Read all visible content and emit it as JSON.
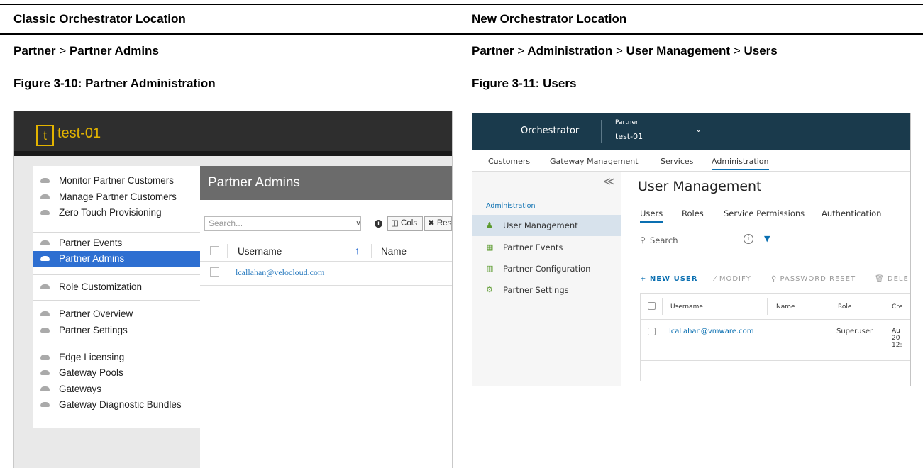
{
  "doc": {
    "left_heading": "Classic Orchestrator Location",
    "right_heading": "New Orchestrator Location",
    "left_path": [
      "Partner",
      "Partner Admins"
    ],
    "right_path": [
      "Partner",
      "Administration",
      "User Management",
      "Users"
    ],
    "path_sep": ">",
    "left_caption": "Figure 3-10: Partner Administration",
    "right_caption": "Figure 3-11: Users"
  },
  "classic": {
    "logo_letter": "t",
    "brand": "test-01",
    "nav_groups": [
      [
        "Monitor Partner Customers",
        "Manage Partner Customers",
        "Zero Touch Provisioning"
      ],
      [
        "Partner Events",
        "Partner Admins"
      ],
      [
        "Role Customization"
      ],
      [
        "Partner Overview",
        "Partner Settings"
      ],
      [
        "Edge Licensing",
        "Gateway Pools",
        "Gateways",
        "Gateway Diagnostic Bundles"
      ]
    ],
    "active_nav": "Partner Admins",
    "panel_title": "Partner Admins",
    "search_placeholder": "Search...",
    "search_dropdown": "∨",
    "info_icon": "i",
    "btn_cols": "◫ Cols",
    "btn_reset": "✖ Res",
    "col_username": "Username",
    "sort_icon": "↑",
    "col_name": "Name",
    "row_username": "lcallahan@velocloud.com"
  },
  "newui": {
    "app_name": "Orchestrator",
    "partner_label": "Partner",
    "partner_name": "test-01",
    "top_tabs": [
      "Customers",
      "Gateway Management",
      "Services",
      "Administration"
    ],
    "active_top_tab": "Administration",
    "collapse_icon": "≪",
    "side_section": "Administration",
    "side_items": [
      "User Management",
      "Partner Events",
      "Partner Configuration",
      "Partner Settings"
    ],
    "active_side": "User Management",
    "page_title": "User Management",
    "sub_tabs": [
      "Users",
      "Roles",
      "Service Permissions",
      "Authentication"
    ],
    "active_sub_tab": "Users",
    "search_placeholder": "Search",
    "actions": {
      "new_user": "+ NEW USER",
      "modify": "⁄ MODIFY",
      "password_reset": "⚲ PASSWORD RESET",
      "delete": "🗑 DELE"
    },
    "columns": [
      "Username",
      "Name",
      "Role",
      "Cre"
    ],
    "row": {
      "username": "lcallahan@vmware.com",
      "role": "Superuser",
      "created": [
        "Au",
        "20",
        "12:"
      ]
    }
  }
}
